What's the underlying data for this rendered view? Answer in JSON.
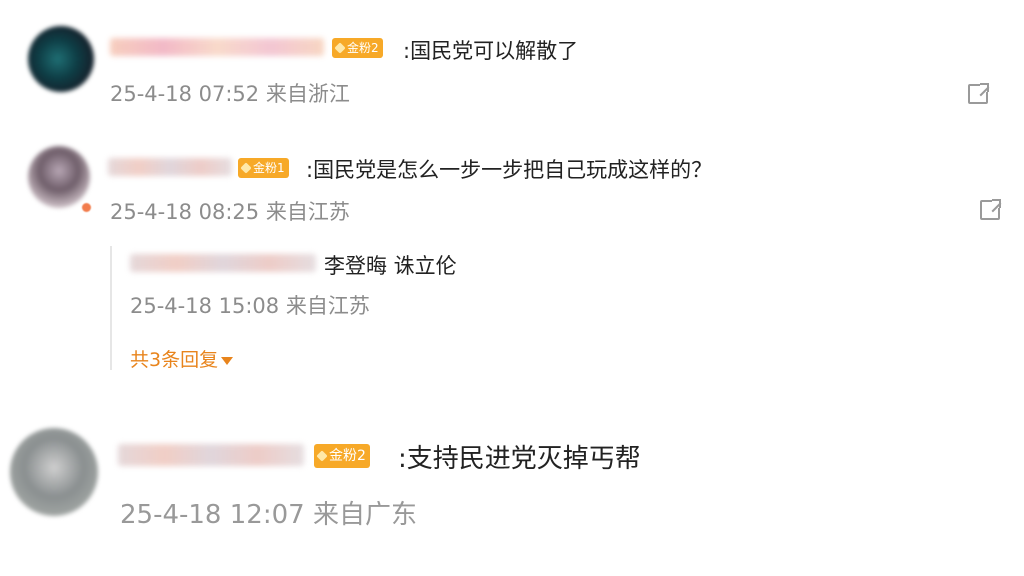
{
  "comments": [
    {
      "badge": "金粉2",
      "text": ":国民党可以解散了",
      "time": "25-4-18 07:52",
      "location": "来自浙江"
    },
    {
      "badge": "金粉1",
      "text": ":国民党是怎么一步一步把自己玩成这样的？",
      "time": "25-4-18 08:25",
      "location": "来自江苏",
      "reply": {
        "text": "李登晦 诛立伦",
        "time": "25-4-18 15:08",
        "location": "来自江苏",
        "more_label": "共3条回复"
      }
    },
    {
      "badge": "金粉2",
      "text": ":支持民进党灭掉丐帮",
      "time": "25-4-18 12:07",
      "location": "来自广东"
    }
  ],
  "colors": {
    "badge": "#f7a928",
    "reply_link": "#e8841c",
    "meta": "#8c8c8c"
  },
  "icons": {
    "share": "share-external-icon",
    "expand": "caret-down-icon"
  }
}
